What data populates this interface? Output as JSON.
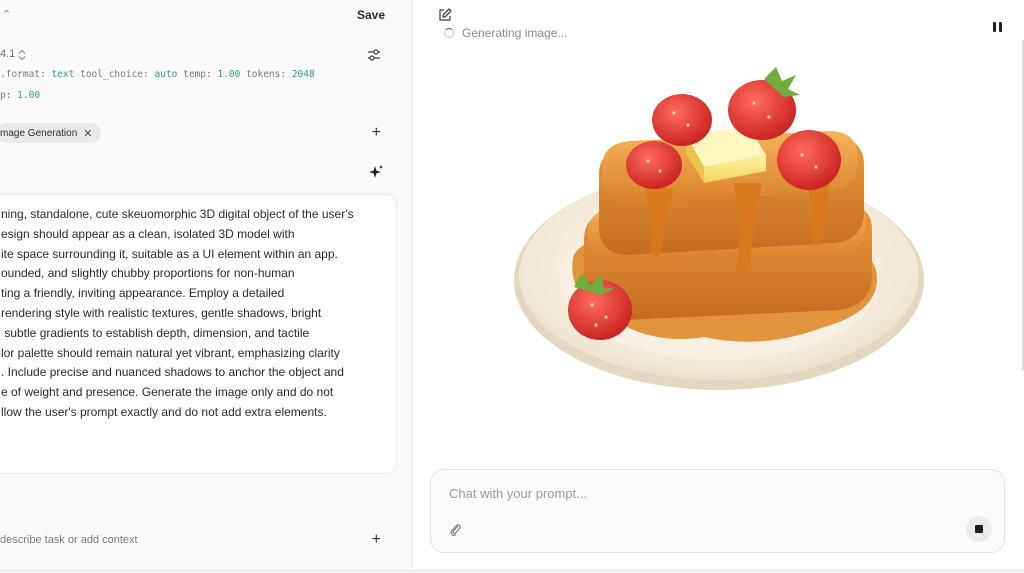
{
  "editor": {
    "save_label": "Save",
    "model_name": "4.1",
    "params_line1": [
      {
        "k": ".format:",
        "v": "text"
      },
      {
        "k": "tool_choice:",
        "v": "auto"
      },
      {
        "k": "temp:",
        "v": "1.00"
      },
      {
        "k": "tokens:",
        "v": "2048"
      }
    ],
    "params_line2": [
      {
        "k": "p:",
        "v": "1.00"
      }
    ],
    "tool_chip_label": "mage Generation",
    "system_prompt": "ning, standalone, cute skeuomorphic 3D digital object of the user's\nesign should appear as a clean, isolated 3D model with\nite space surrounding it, suitable as a UI element within an app.\nounded, and slightly chubby proportions for non-human\nting a friendly, inviting appearance. Employ a detailed\nrendering style with realistic textures, gentle shadows, bright\n subtle gradients to establish depth, dimension, and tactile\nlor palette should remain natural yet vibrant, emphasizing clarity\n. Include precise and nuanced shadows to anchor the object and\ne of weight and presence. Generate the image only and do not\nllow the user's prompt exactly and do not add extra elements.",
    "context_placeholder": "describe task or add context"
  },
  "output": {
    "status_text": "Generating image...",
    "chat_placeholder": "Chat with your prompt..."
  },
  "icons": {
    "edit": "edit-icon",
    "pause": "pause-icon",
    "attach": "paperclip-icon",
    "stop": "stop-icon",
    "sliders": "sliders-icon",
    "sparkle": "sparkle-icon"
  }
}
